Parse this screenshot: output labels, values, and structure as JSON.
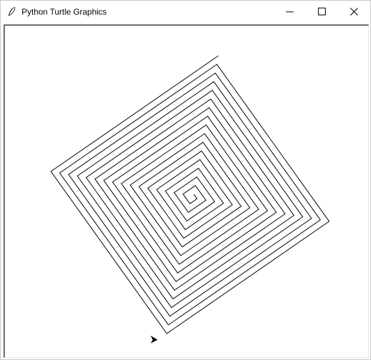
{
  "window": {
    "title": "Python Turtle Graphics",
    "app_icon": "feather-icon"
  },
  "controls": {
    "minimize": "minimize-icon",
    "maximize": "maximize-icon",
    "close": "close-icon"
  },
  "canvas": {
    "background": "#ffffff",
    "pen_color": "#000000",
    "drawing": "square-spiral",
    "turtle_shape": "arrow-icon"
  }
}
